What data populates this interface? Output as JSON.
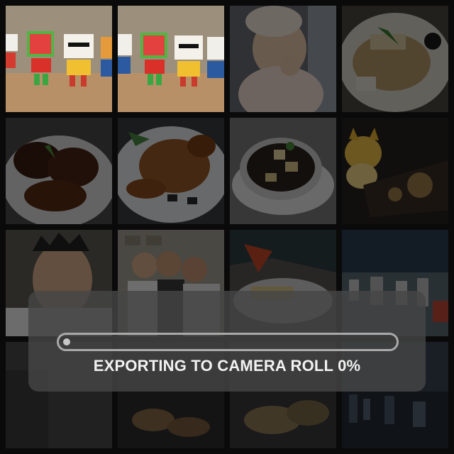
{
  "gallery": {
    "tiles": [
      {
        "subject": "toy figures",
        "dimmed": false
      },
      {
        "subject": "toy figures",
        "dimmed": false
      },
      {
        "subject": "baby",
        "dimmed": true
      },
      {
        "subject": "food plate",
        "dimmed": true
      },
      {
        "subject": "glazed meat",
        "dimmed": true
      },
      {
        "subject": "roast chicken",
        "dimmed": true
      },
      {
        "subject": "soup bowl",
        "dimmed": true
      },
      {
        "subject": "cat toy",
        "dimmed": true
      },
      {
        "subject": "selfie",
        "dimmed": true
      },
      {
        "subject": "group photo",
        "dimmed": true
      },
      {
        "subject": "dish",
        "dimmed": true
      },
      {
        "subject": "city skyline",
        "dimmed": true
      },
      {
        "subject": "room",
        "dimmed": true
      },
      {
        "subject": "food",
        "dimmed": true
      },
      {
        "subject": "food",
        "dimmed": true
      },
      {
        "subject": "city night",
        "dimmed": true
      }
    ]
  },
  "export_dialog": {
    "status_text": "EXPORTING TO CAMERA ROLL 0%",
    "progress_fraction": 0.0
  },
  "colors": {
    "overlay_bg": "#464646",
    "progress_border": "#a9a9a9",
    "text": "#f2f2f2"
  }
}
